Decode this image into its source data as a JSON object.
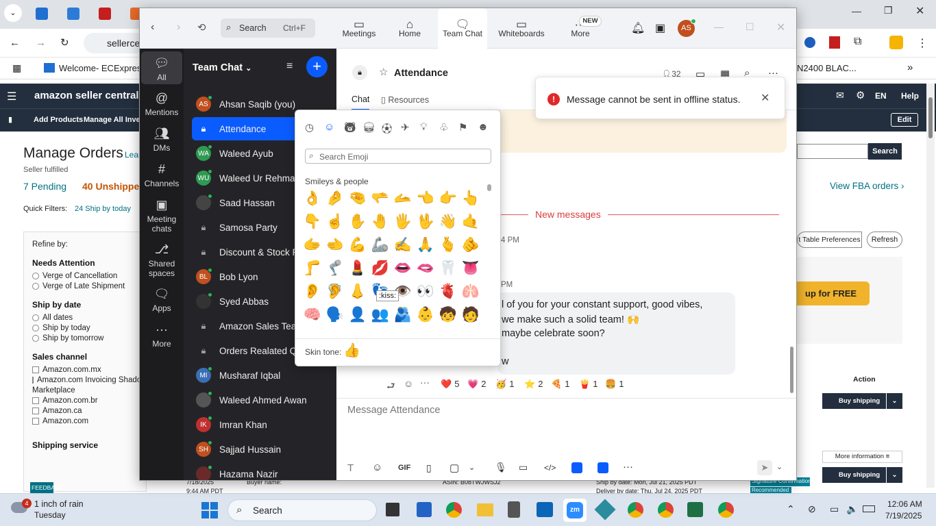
{
  "browser": {
    "tab_icons": [
      "ec-icon",
      "blue-app-icon",
      "red-app-icon",
      "orange-app-icon"
    ],
    "address": "sellerce",
    "bookmark_welcome": "Welcome- ECExpres...",
    "bookmark_right": "N2400 BLAC..."
  },
  "amazon": {
    "brand": "amazon seller central",
    "nav_add_products": "Add Products",
    "nav_manage": "Manage All Invent",
    "lang": "EN",
    "help": "Help",
    "edit": "Edit",
    "page_title": "Manage Orders",
    "learn": "Lear",
    "seller_fulfilled": "Seller fulfilled",
    "pending": "7 Pending",
    "unshipped": "40 Unshipped",
    "quick_filters": "Quick Filters:",
    "ship_today": "24 Ship by today",
    "refine_by": "Refine by:",
    "needs_attention": "Needs Attention",
    "na_opts": [
      "Verge of Cancellation",
      "Verge of Late Shipment"
    ],
    "ship_by_date": "Ship by date",
    "sbd_opts": [
      "All dates",
      "Ship by today",
      "Ship by tomorrow"
    ],
    "sales_channel": "Sales channel",
    "sc_opts": [
      "Amazon.com.mx",
      "Amazon.com Invoicing Shado",
      "Marketplace",
      "Amazon.com.br",
      "Amazon.ca",
      "Amazon.com"
    ],
    "shipping_service": "Shipping service",
    "feedback": "FEEDBACK",
    "search_btn": "Search",
    "fba_link": "View FBA orders ›",
    "table_prefs": "t Table Preferences",
    "refresh": "Refresh",
    "promo": "up for FREE",
    "action": "Action",
    "buy_shipping": "Buy shipping",
    "more_info": "More information ≡",
    "row_date": "7/18/2025",
    "row_time": "9:44 AM PDT",
    "buyer_name": "Buyer name:",
    "asin": "ASIN: B08TWJWSJ2",
    "ship_by": "Ship by date: Mon, Jul 21, 2025 PDT",
    "deliver_by": "Deliver by date: Thu, Jul 24, 2025 PDT",
    "sig_conf": "Signature Confirmation",
    "recommended": "Recommended"
  },
  "zoom": {
    "search_label": "Search",
    "search_shortcut": "Ctrl+F",
    "nav": [
      "Meetings",
      "Home",
      "Team Chat",
      "Whiteboards",
      "More"
    ],
    "new_badge": "NEW",
    "avatar_initials": "AS",
    "rail": [
      "All",
      "Mentions",
      "DMs",
      "Channels",
      "Meeting chats",
      "Shared spaces",
      "Apps",
      "More"
    ],
    "list_title": "Team Chat",
    "chats": [
      {
        "name": "Ahsan Saqib (you)",
        "initials": "AS",
        "color": "#c0501f",
        "type": "user"
      },
      {
        "name": "Attendance",
        "initials": "",
        "color": "",
        "type": "channel"
      },
      {
        "name": "Waleed Ayub",
        "initials": "WA",
        "color": "#2f9a52",
        "type": "user"
      },
      {
        "name": "Waleed Ur Rehman",
        "initials": "WU",
        "color": "#2f9a52",
        "type": "user"
      },
      {
        "name": "Saad Hassan",
        "initials": "",
        "color": "#444",
        "type": "photo"
      },
      {
        "name": "Samosa Party",
        "initials": "",
        "color": "",
        "type": "channel"
      },
      {
        "name": "Discount & Stock R",
        "initials": "",
        "color": "",
        "type": "channel"
      },
      {
        "name": "Bob Lyon",
        "initials": "BL",
        "color": "#c0501f",
        "type": "user"
      },
      {
        "name": "Syed Abbas",
        "initials": "",
        "color": "#333",
        "type": "photo"
      },
      {
        "name": "Amazon Sales Tean",
        "initials": "",
        "color": "",
        "type": "channel"
      },
      {
        "name": "Orders Realated Q",
        "initials": "",
        "color": "",
        "type": "channel"
      },
      {
        "name": "Musharaf Iqbal",
        "initials": "MI",
        "color": "#3a6fb5",
        "type": "user"
      },
      {
        "name": "Waleed Ahmed Awan",
        "initials": "",
        "color": "#555",
        "type": "photo"
      },
      {
        "name": "Imran Khan",
        "initials": "IK",
        "color": "#c03030",
        "type": "user"
      },
      {
        "name": "Sajjad Hussain",
        "initials": "SH",
        "color": "#c0501f",
        "type": "user"
      },
      {
        "name": "Hazama Nazir",
        "initials": "",
        "color": "#6a2a2a",
        "type": "photo"
      }
    ],
    "channel_name": "Attendance",
    "member_count": "32",
    "tab_chat": "Chat",
    "tab_resources": "Resources",
    "new_messages": "New messages",
    "time1": "4 PM",
    "time2": "PM",
    "msg_line1": "l of you for your constant support, good vibes,",
    "msg_line2": "we make such a solid team! 🙌",
    "msg_line3": "maybe celebrate soon?",
    "msg_line4": "w",
    "reactions": [
      {
        "emoji": "❤️",
        "count": "5"
      },
      {
        "emoji": "💗",
        "count": "2"
      },
      {
        "emoji": "🥳",
        "count": "1"
      },
      {
        "emoji": "⭐",
        "count": "2"
      },
      {
        "emoji": "🍕",
        "count": "1"
      },
      {
        "emoji": "🍟",
        "count": "1"
      },
      {
        "emoji": "🍔",
        "count": "1"
      }
    ],
    "composer_placeholder": "Message Attendance",
    "toast_text": "Message cannot be sent in offline status.",
    "picker": {
      "search_placeholder": "Search Emoji",
      "section": "Smileys & people",
      "tooltip": ":kiss:",
      "skin_tone": "Skin tone:",
      "rows": [
        [
          "👌",
          "🤌",
          "🤏",
          "🫳",
          "🫴",
          "👈",
          "👉",
          "👆"
        ],
        [
          "👇",
          "☝️",
          "✋",
          "🤚",
          "🖐️",
          "🖖",
          "👋",
          "🤙"
        ],
        [
          "🫱",
          "🫲",
          "💪",
          "🦾",
          "✍️",
          "🙏",
          "🫰",
          "🫵"
        ],
        [
          "🦵",
          "🦿",
          "💄",
          "💋",
          "👄",
          "🫦",
          "🦷",
          "👅"
        ],
        [
          "👂",
          "🦻",
          "👃",
          "👣",
          "👁️",
          "👀",
          "🫀",
          "🫁"
        ],
        [
          "🧠",
          "🗣️",
          "👤",
          "👥",
          "🫂",
          "👶",
          "🧒",
          "🧑"
        ]
      ]
    }
  },
  "taskbar": {
    "weather_badge": "4",
    "weather": "1 inch of rain",
    "weather_day": "Tuesday",
    "search": "Search",
    "time": "12:06 AM",
    "date": "7/19/2025"
  }
}
